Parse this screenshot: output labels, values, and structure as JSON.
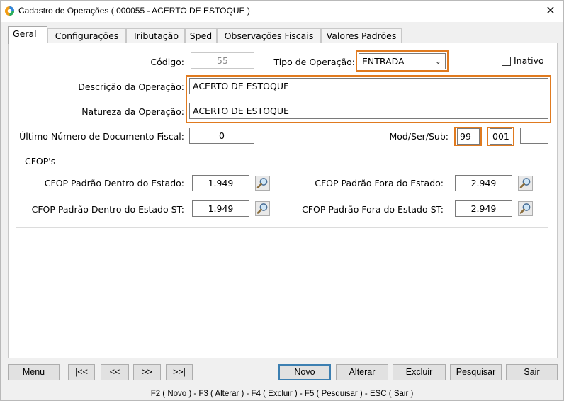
{
  "window": {
    "title": "Cadastro de Operações ( 000055 - ACERTO DE ESTOQUE )",
    "close_glyph": "✕"
  },
  "tabs": [
    {
      "label": "Geral",
      "active": true
    },
    {
      "label": "Configurações",
      "active": false
    },
    {
      "label": "Tributação",
      "active": false
    },
    {
      "label": "Sped",
      "active": false
    },
    {
      "label": "Observações Fiscais",
      "active": false
    },
    {
      "label": "Valores Padrões",
      "active": false
    }
  ],
  "form": {
    "codigo_label": "Código:",
    "codigo_value": "55",
    "tipo_label": "Tipo de Operação:",
    "tipo_value": "ENTRADA",
    "inativo_label": "Inativo",
    "inativo_checked": false,
    "descricao_label": "Descrição da Operação:",
    "descricao_value": "ACERTO DE ESTOQUE",
    "natureza_label": "Natureza da Operação:",
    "natureza_value": "ACERTO DE ESTOQUE",
    "ultimo_label": "Último Número de Documento Fiscal:",
    "ultimo_value": "0",
    "modsersub_label": "Mod/Ser/Sub:",
    "mod_value": "99",
    "ser_value": "001",
    "sub_value": ""
  },
  "cfop": {
    "legend": "CFOP's",
    "dentro_label": "CFOP Padrão Dentro do Estado:",
    "dentro_value": "1.949",
    "fora_label": "CFOP Padrão Fora do Estado:",
    "fora_value": "2.949",
    "dentro_st_label": "CFOP Padrão Dentro do Estado ST:",
    "dentro_st_value": "1.949",
    "fora_st_label": "CFOP Padrão Fora do Estado ST:",
    "fora_st_value": "2.949"
  },
  "buttons": {
    "menu": "Menu",
    "first": "|<<",
    "prev": "<<",
    "next": ">>",
    "last": ">>|",
    "novo": "Novo",
    "alterar": "Alterar",
    "excluir": "Excluir",
    "pesquisar": "Pesquisar",
    "sair": "Sair"
  },
  "statusbar": "F2 ( Novo )  -  F3 ( Alterar )  -  F4 ( Excluir )  -  F5 ( Pesquisar )  -  ESC ( Sair )",
  "colors": {
    "highlight": "#e07a1f",
    "default_button_border": "#3c7fb1"
  },
  "icons": {
    "app": "app-logo-icon",
    "close": "close-icon",
    "search": "magnifier-icon",
    "dropdown": "chevron-down-icon"
  }
}
